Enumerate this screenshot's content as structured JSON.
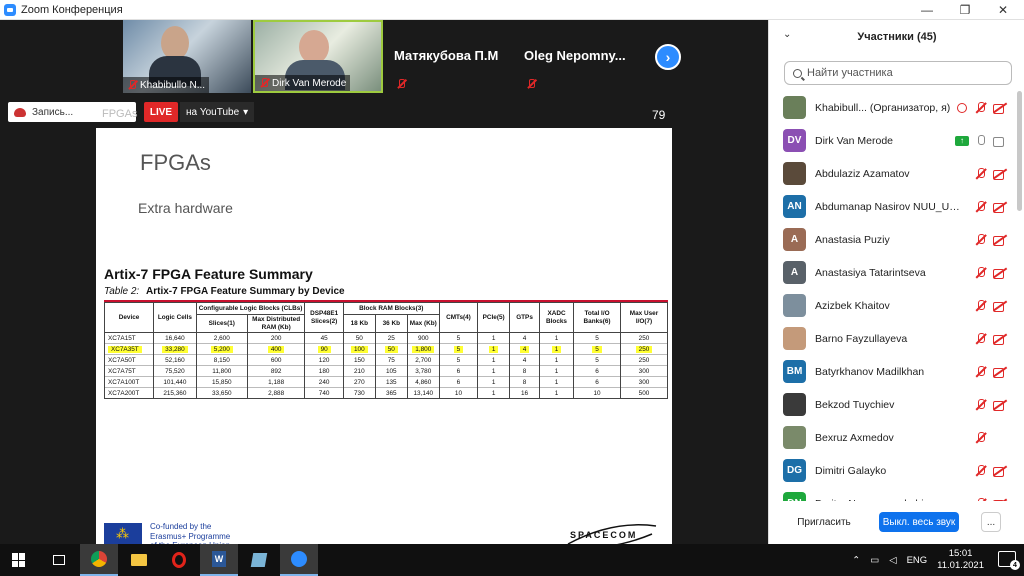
{
  "window": {
    "title": "Zoom Конференция",
    "minimize": "—",
    "maximize": "❐",
    "close": "✕"
  },
  "thumbnails": [
    {
      "name": "Khabibullo N...",
      "muted": true
    },
    {
      "name": "Dirk Van Merode",
      "muted": true
    },
    {
      "name": "Матякубова П.М",
      "muted": true
    },
    {
      "name": "Oleg  Nepomny...",
      "muted": true
    }
  ],
  "toolbar": {
    "recording_label": "Запись...",
    "live_label": "LIVE",
    "youtube_label": "на YouTube",
    "share_name": "FPGAs",
    "page_number": "79"
  },
  "slide": {
    "title": "FPGAs",
    "subtitle": "Extra hardware",
    "table_title": "Artix-7 FPGA Feature Summary",
    "caption_num": "Table  2:",
    "caption_text": "Artix-7 FPGA Feature Summary by Device",
    "headers": {
      "device": "Device",
      "logic_cells": "Logic Cells",
      "clbs": "Configurable Logic Blocks (CLBs)",
      "slices": "Slices(1)",
      "max_ram": "Max Distributed RAM (Kb)",
      "dsp": "DSP48E1 Slices(2)",
      "bram": "Block RAM Blocks(3)",
      "b18": "18 Kb",
      "b36": "36 Kb",
      "bmax": "Max (Kb)",
      "cmts": "CMTs(4)",
      "pcie": "PCIe(5)",
      "gtps": "GTPs",
      "xadc": "XADC Blocks",
      "io_banks": "Total I/O Banks(6)",
      "max_io": "Max User I/O(7)"
    },
    "rows": [
      {
        "device": "XC7A15T",
        "cells": "16,640",
        "slices": "2,600",
        "ram": "200",
        "dsp": "45",
        "b18": "50",
        "b36": "25",
        "bmax": "900",
        "cmts": "5",
        "pcie": "1",
        "gtps": "4",
        "xadc": "1",
        "banks": "5",
        "io": "250",
        "highlight": false
      },
      {
        "device": "XC7A35T",
        "cells": "33,280",
        "slices": "5,200",
        "ram": "400",
        "dsp": "90",
        "b18": "100",
        "b36": "50",
        "bmax": "1,800",
        "cmts": "5",
        "pcie": "1",
        "gtps": "4",
        "xadc": "1",
        "banks": "5",
        "io": "250",
        "highlight": true
      },
      {
        "device": "XC7A50T",
        "cells": "52,160",
        "slices": "8,150",
        "ram": "600",
        "dsp": "120",
        "b18": "150",
        "b36": "75",
        "bmax": "2,700",
        "cmts": "5",
        "pcie": "1",
        "gtps": "4",
        "xadc": "1",
        "banks": "5",
        "io": "250",
        "highlight": false
      },
      {
        "device": "XC7A75T",
        "cells": "75,520",
        "slices": "11,800",
        "ram": "892",
        "dsp": "180",
        "b18": "210",
        "b36": "105",
        "bmax": "3,780",
        "cmts": "6",
        "pcie": "1",
        "gtps": "8",
        "xadc": "1",
        "banks": "6",
        "io": "300",
        "highlight": false
      },
      {
        "device": "XC7A100T",
        "cells": "101,440",
        "slices": "15,850",
        "ram": "1,188",
        "dsp": "240",
        "b18": "270",
        "b36": "135",
        "bmax": "4,860",
        "cmts": "6",
        "pcie": "1",
        "gtps": "8",
        "xadc": "1",
        "banks": "6",
        "io": "300",
        "highlight": false
      },
      {
        "device": "XC7A200T",
        "cells": "215,360",
        "slices": "33,650",
        "ram": "2,888",
        "dsp": "740",
        "b18": "730",
        "b36": "365",
        "bmax": "13,140",
        "cmts": "10",
        "pcie": "1",
        "gtps": "16",
        "xadc": "1",
        "banks": "10",
        "io": "500",
        "highlight": false
      }
    ],
    "eu_text_1": "Co-funded by the",
    "eu_text_2": "Erasmus+ Programme",
    "eu_text_3": "of the European Union",
    "logo_text": "SPACECOM"
  },
  "panel": {
    "title": "Участники (45)",
    "search_placeholder": "Найти участника",
    "participants": [
      {
        "name": "Khabibull... (Организатор, я)",
        "initials": "",
        "color": "#6a7f5a",
        "mic": "off",
        "cam": "off",
        "extra": "rec"
      },
      {
        "name": "Dirk Van Merode",
        "initials": "DV",
        "color": "#8b4fb3",
        "mic": "on",
        "cam": "on",
        "extra": "share"
      },
      {
        "name": "Abdulaziz Azamatov",
        "initials": "",
        "color": "#5a4a3a",
        "mic": "off",
        "cam": "off",
        "extra": ""
      },
      {
        "name": "Abdumanap Nasirov NUU_Uzb...",
        "initials": "AN",
        "color": "#1d6fa8",
        "mic": "off",
        "cam": "off",
        "extra": ""
      },
      {
        "name": "Anastasia Puziy",
        "initials": "A",
        "color": "#9a6b55",
        "mic": "off",
        "cam": "off",
        "extra": ""
      },
      {
        "name": "Anastasiya Tatarintseva",
        "initials": "A",
        "color": "#596169",
        "mic": "off",
        "cam": "off",
        "extra": ""
      },
      {
        "name": "Azizbek Khaitov",
        "initials": "",
        "color": "#7d8f9d",
        "mic": "off",
        "cam": "off",
        "extra": ""
      },
      {
        "name": "Barno Fayzullayeva",
        "initials": "",
        "color": "#c49a7a",
        "mic": "off",
        "cam": "off",
        "extra": ""
      },
      {
        "name": "Batyrkhanov Madilkhan",
        "initials": "BM",
        "color": "#1d6fa8",
        "mic": "off",
        "cam": "off",
        "extra": ""
      },
      {
        "name": "Bekzod Tuychiev",
        "initials": "",
        "color": "#3a3a3a",
        "mic": "off",
        "cam": "off",
        "extra": ""
      },
      {
        "name": "Bexruz Axmedov",
        "initials": "",
        "color": "#7a8a6a",
        "mic": "off",
        "cam": "none",
        "extra": ""
      },
      {
        "name": "Dimitri Galayko",
        "initials": "DG",
        "color": "#1d6fa8",
        "mic": "off",
        "cam": "off",
        "extra": ""
      },
      {
        "name": "Dmitry Nepomnyashchiy",
        "initials": "DN",
        "color": "#1ea83c",
        "mic": "off",
        "cam": "off",
        "extra": ""
      }
    ],
    "invite_label": "Пригласить",
    "mute_all_label": "Выкл. весь звук",
    "more_label": "..."
  },
  "taskbar": {
    "lang": "ENG",
    "time": "15:01",
    "date": "11.01.2021",
    "notifications": "4"
  }
}
